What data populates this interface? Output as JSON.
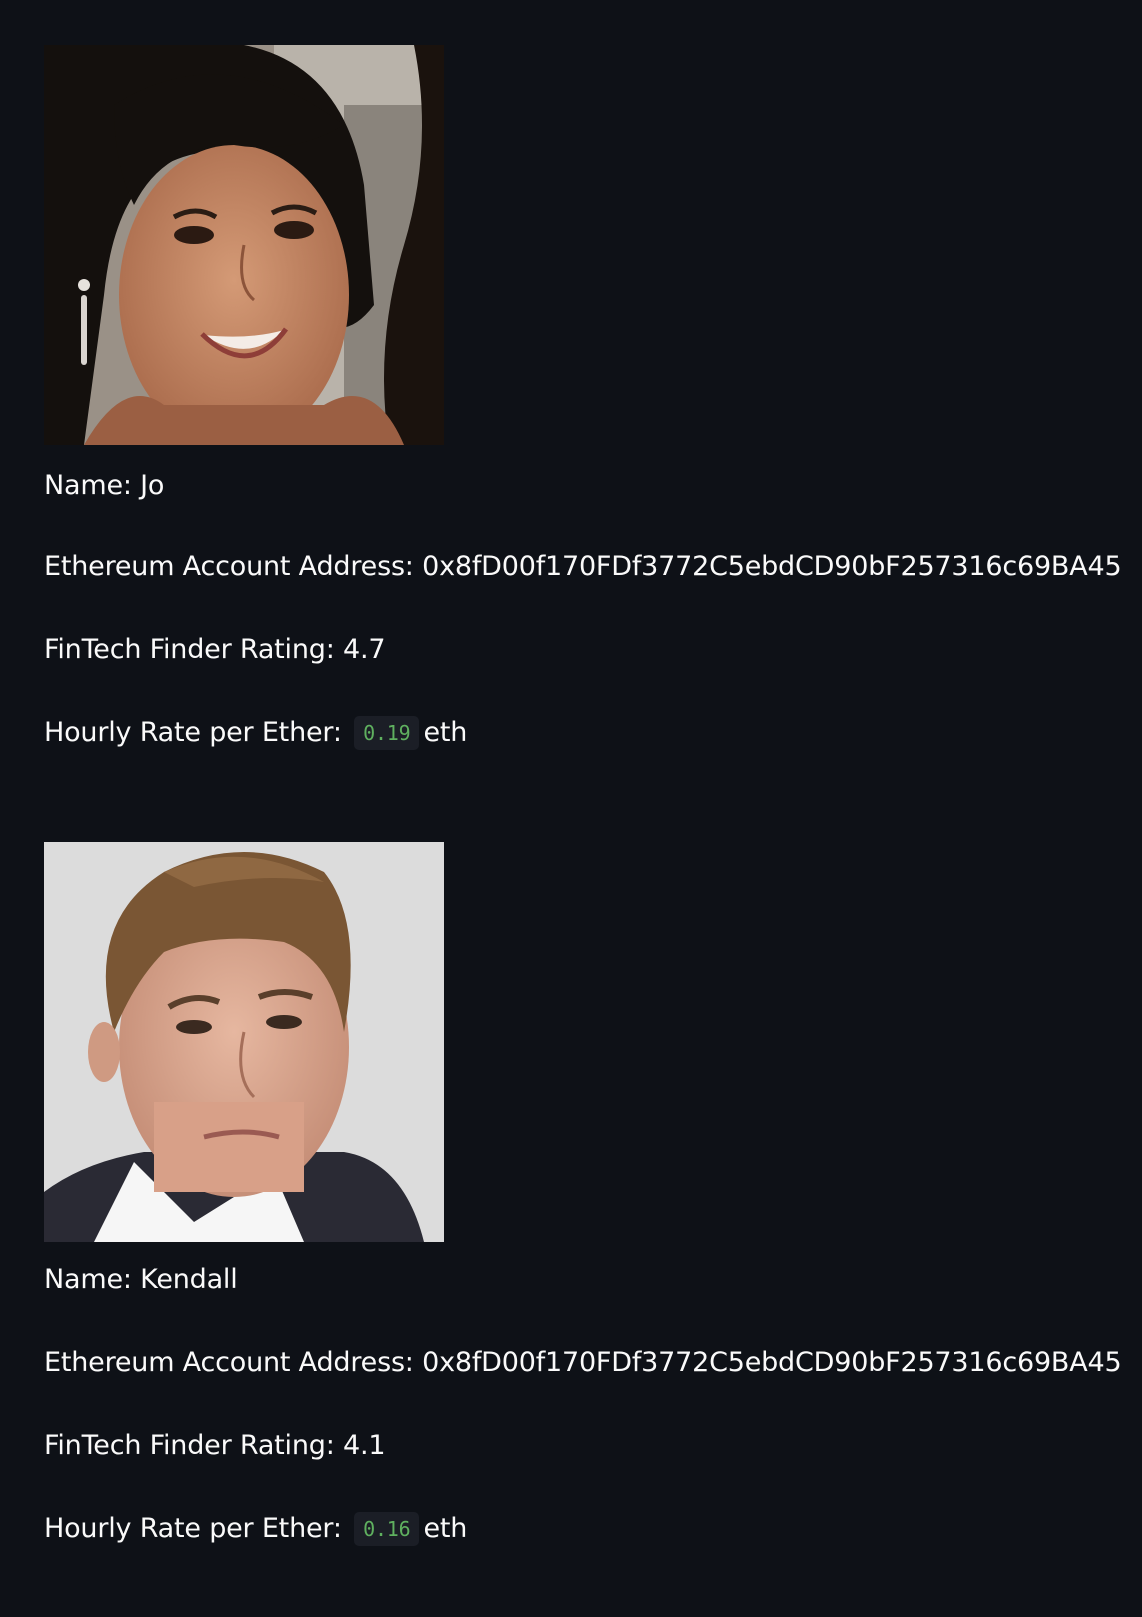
{
  "candidates": [
    {
      "photo_alt": "photo-woman",
      "name_label": "Name:",
      "name": "Jo",
      "address_label": "Ethereum Account Address:",
      "address": "0x8fD00f170FDf3772C5ebdCD90bF257316c69BA45",
      "rating_label": "FinTech Finder Rating:",
      "rating": "4.7",
      "rate_label": "Hourly Rate per Ether:",
      "rate": "0.19",
      "rate_unit": "eth"
    },
    {
      "photo_alt": "photo-man",
      "name_label": "Name:",
      "name": "Kendall",
      "address_label": "Ethereum Account Address:",
      "address": "0x8fD00f170FDf3772C5ebdCD90bF257316c69BA45",
      "rating_label": "FinTech Finder Rating:",
      "rating": "4.1",
      "rate_label": "Hourly Rate per Ether:",
      "rate": "0.16",
      "rate_unit": "eth"
    }
  ],
  "colors": {
    "background": "#0e1117",
    "text": "#fafafa",
    "code_text": "#5fb05f",
    "code_bg": "#1b1e26"
  }
}
